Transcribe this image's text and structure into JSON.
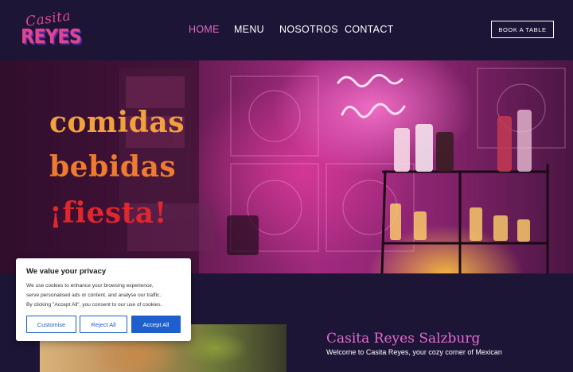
{
  "brand": {
    "logo_top": "Casita",
    "logo_bottom": "REYES"
  },
  "nav": {
    "items": [
      {
        "label": "HOME",
        "active": true
      },
      {
        "label": "MENU",
        "active": false
      },
      {
        "label": "NOSOTROS",
        "active": false
      },
      {
        "label": "CONTACT",
        "active": false
      }
    ],
    "cta": "BOOK A TABLE"
  },
  "hero": {
    "lines": [
      "comidas",
      "bebidas",
      "¡fiesta!"
    ],
    "colors": {
      "line1": "#f2a23d",
      "line2": "#ee7b2e",
      "line3": "#e0262f"
    }
  },
  "intro": {
    "title": "Casita Reyes Salzburg",
    "text": "Welcome to Casita Reyes, your cozy corner of Mexican"
  },
  "cookie_banner": {
    "title": "We value your privacy",
    "lines": [
      "We use cookies to enhance your browsing experience,",
      "serve personalised ads or content, and analyse our traffic.",
      "By clicking \"Accept All\", you consent to our use of cookies."
    ],
    "buttons": {
      "customise": "Customise",
      "reject": "Reject All",
      "accept": "Accept All"
    }
  },
  "theme": {
    "background": "#1c1536",
    "accent": "#e26bc3",
    "button_blue": "#1e5fcc"
  }
}
